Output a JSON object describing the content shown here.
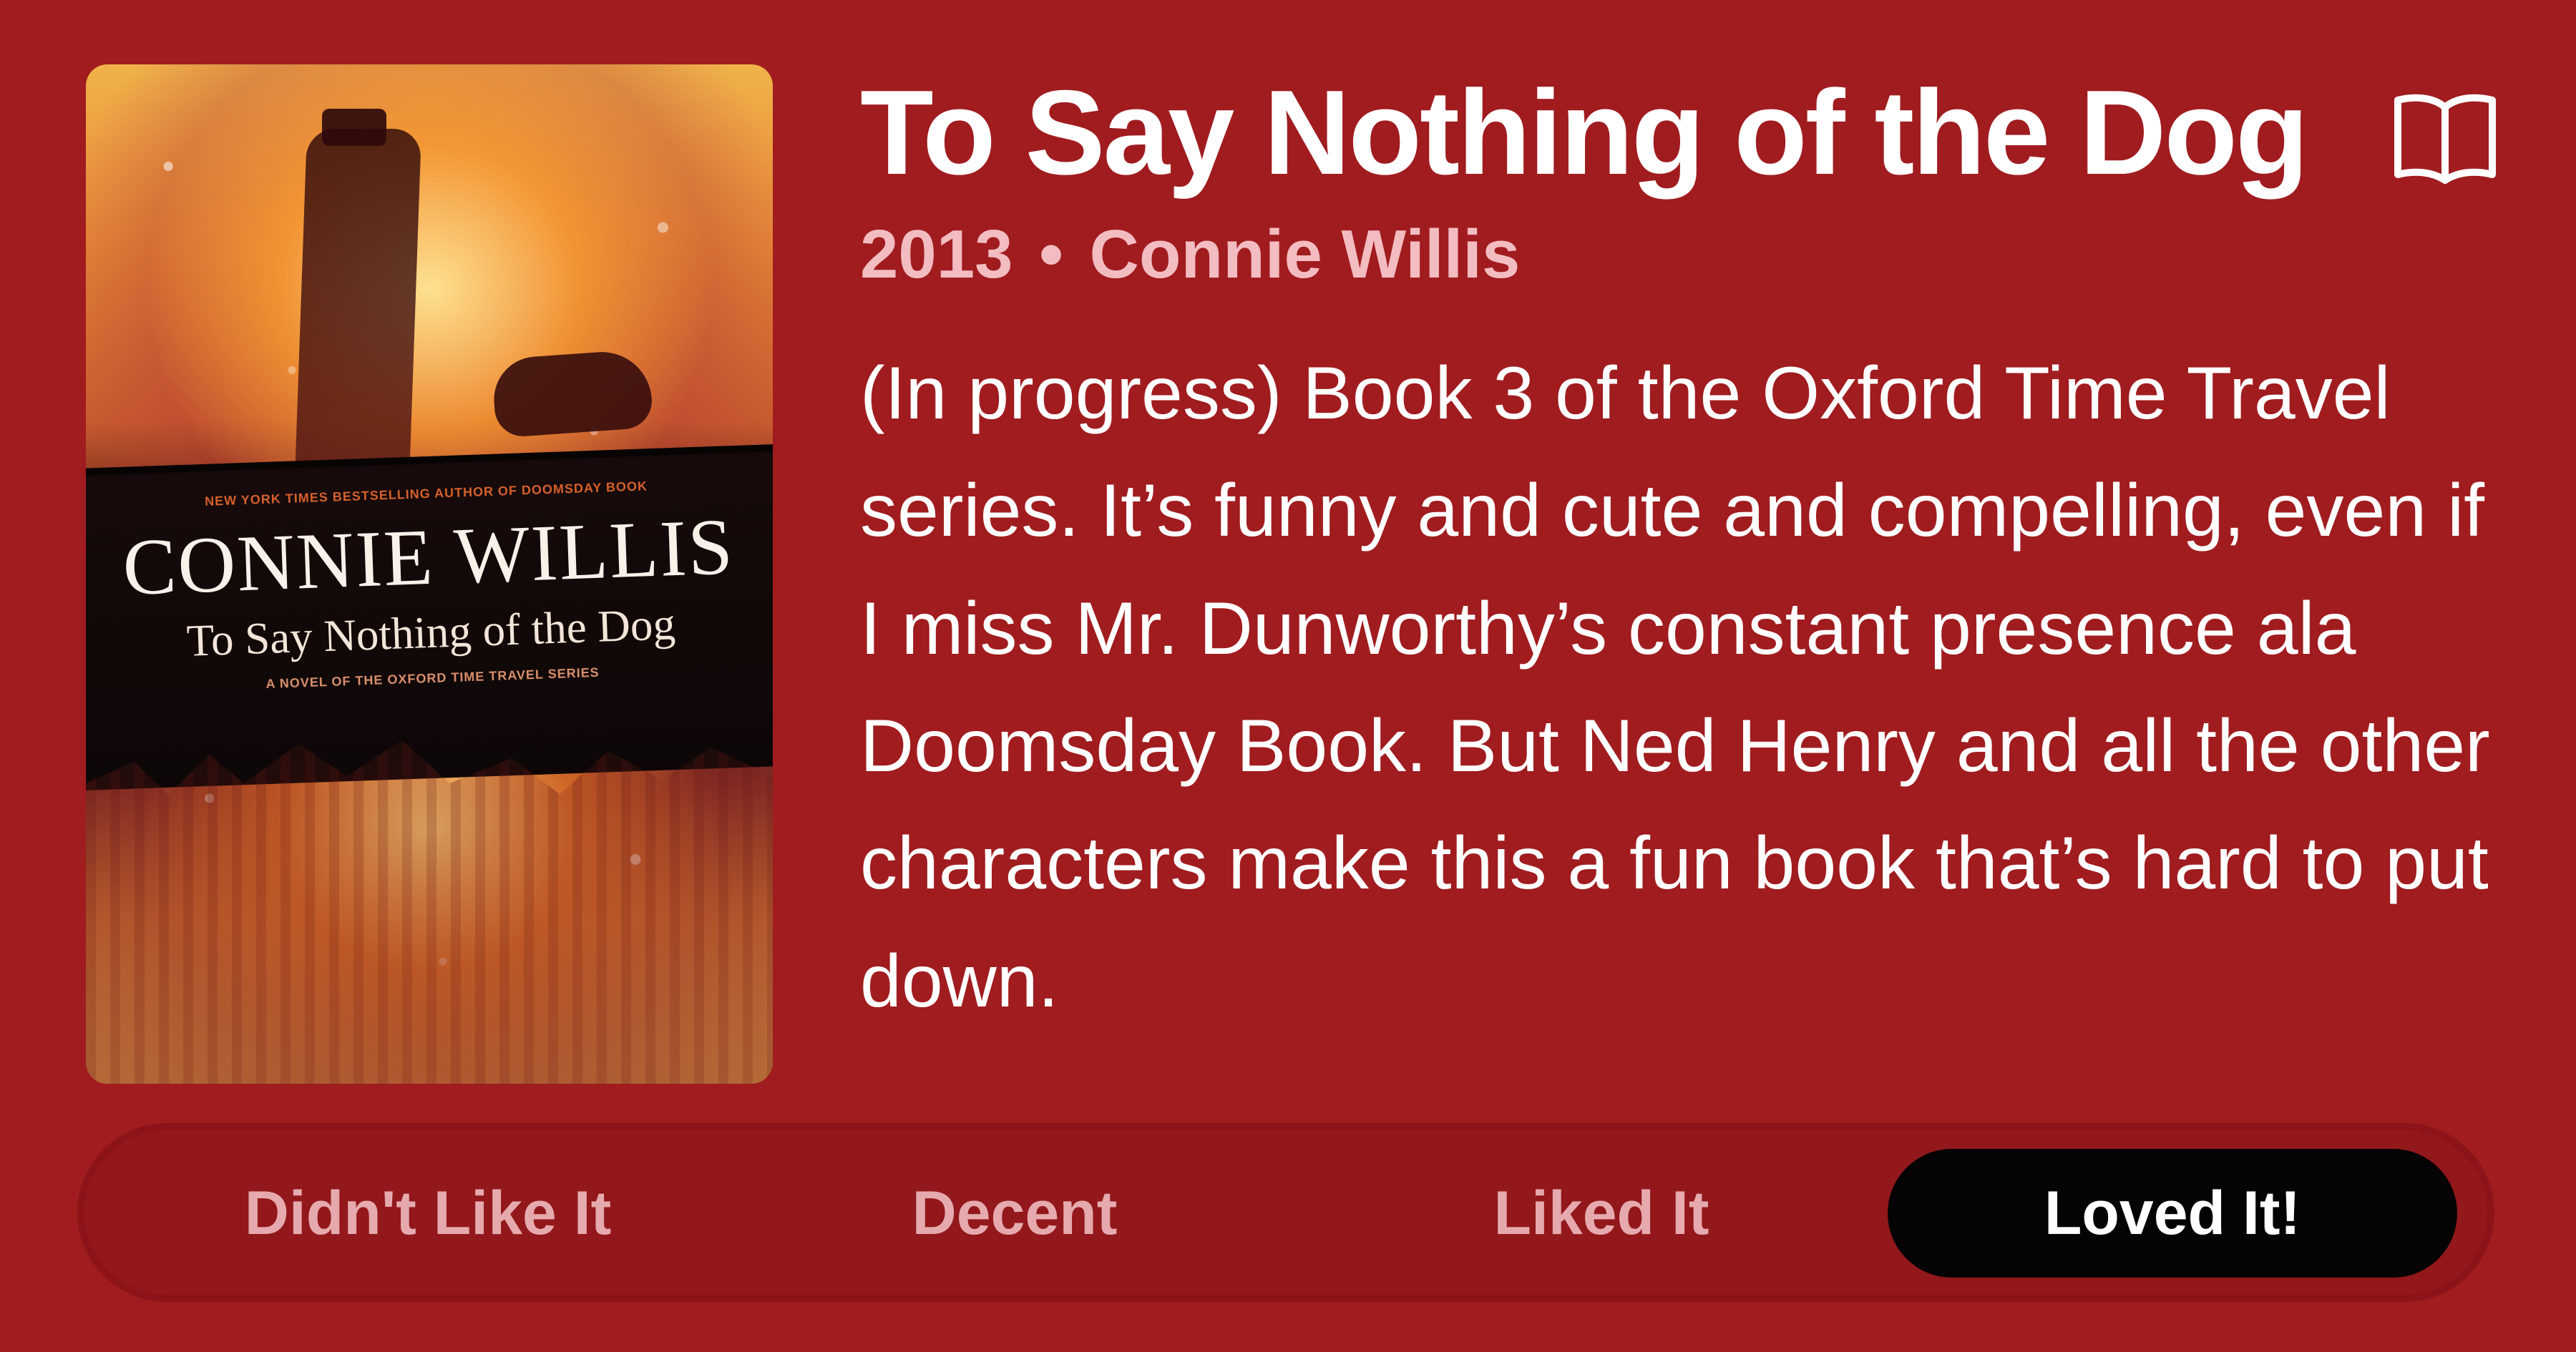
{
  "book": {
    "title": "To Say Nothing of the Dog",
    "year": "2013",
    "author": "Connie Willis",
    "description": "(In progress) Book 3 of the Oxford Time Travel series. It’s funny and cute and compelling, even if I miss Mr. Dunworthy’s constant presence ala Doomsday Book. But Ned Henry and all the other characters make this a fun book that’s hard to put down.",
    "meta_separator": "•"
  },
  "cover": {
    "kicker": "NEW YORK TIMES BESTSELLING AUTHOR OF DOOMSDAY BOOK",
    "author": "CONNIE WILLIS",
    "title": "To Say Nothing of the Dog",
    "series": "A NOVEL OF THE OXFORD TIME TRAVEL SERIES"
  },
  "actions": {
    "book_icon": "open-book-icon"
  },
  "rating": {
    "options": [
      "Didn't Like It",
      "Decent",
      "Liked It",
      "Loved It!"
    ],
    "selected": "Loved It!"
  },
  "colors": {
    "background": "#a01c1f",
    "title": "#ffffff",
    "meta": "#f3bcc1",
    "description": "#ffffff",
    "segment_track": "#8f171a",
    "segment_unselected_text": "#e6aaae",
    "segment_selected_bg": "#050304",
    "segment_selected_text": "#ffffff"
  }
}
